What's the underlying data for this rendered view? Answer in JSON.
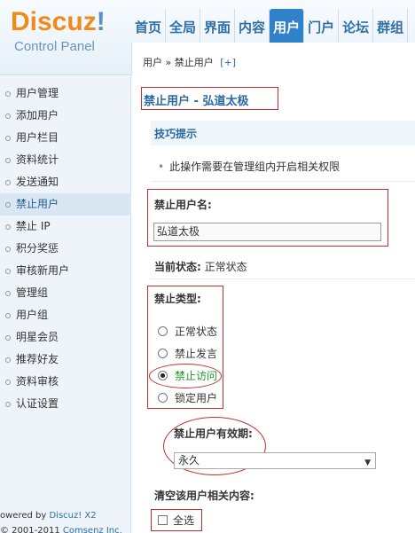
{
  "header": {
    "logo_text": "Discuz",
    "logo_mark": "!",
    "logo_sub": "Control Panel",
    "nav": [
      {
        "label": "首页",
        "active": false
      },
      {
        "label": "全局",
        "active": false
      },
      {
        "label": "界面",
        "active": false
      },
      {
        "label": "内容",
        "active": false
      },
      {
        "label": "用户",
        "active": true
      },
      {
        "label": "门户",
        "active": false
      },
      {
        "label": "论坛",
        "active": false
      },
      {
        "label": "群组",
        "active": false
      }
    ],
    "breadcrumb": "用户 » 禁止用户",
    "breadcrumb_plus": "[+]"
  },
  "sidebar": {
    "items": [
      {
        "label": "用户管理"
      },
      {
        "label": "添加用户"
      },
      {
        "label": "用户栏目"
      },
      {
        "label": "资料统计"
      },
      {
        "label": "发送通知"
      },
      {
        "label": "禁止用户"
      },
      {
        "label": "禁止 IP"
      },
      {
        "label": "积分奖惩"
      },
      {
        "label": "审核新用户"
      },
      {
        "label": "管理组"
      },
      {
        "label": "用户组"
      },
      {
        "label": "明星会员"
      },
      {
        "label": "推荐好友"
      },
      {
        "label": "资料审核"
      },
      {
        "label": "认证设置"
      }
    ],
    "active_index": 5,
    "powered_prefix": "owered by ",
    "powered_link": "Discuz! X2",
    "copyright_prefix": "© 2001-2011 ",
    "copyright_link": "Comsenz Inc."
  },
  "main": {
    "title": "禁止用户 - 弘道太极",
    "tips_title": "技巧提示",
    "tip_text": "此操作需要在管理组内开启相关权限",
    "username_label": "禁止用户名:",
    "username_value": "弘道太极",
    "status_label": "当前状态:",
    "status_value": " 正常状态",
    "ban_type_label": "禁止类型:",
    "ban_types": [
      {
        "label": "正常状态",
        "checked": false
      },
      {
        "label": "禁止发言",
        "checked": false
      },
      {
        "label": "禁止访问",
        "checked": true
      },
      {
        "label": "锁定用户",
        "checked": false
      }
    ],
    "expiry_label": "禁止用户有效期:",
    "expiry_value": "永久",
    "clear_label": "清空该用户相关内容:",
    "select_all_label": "全选"
  }
}
